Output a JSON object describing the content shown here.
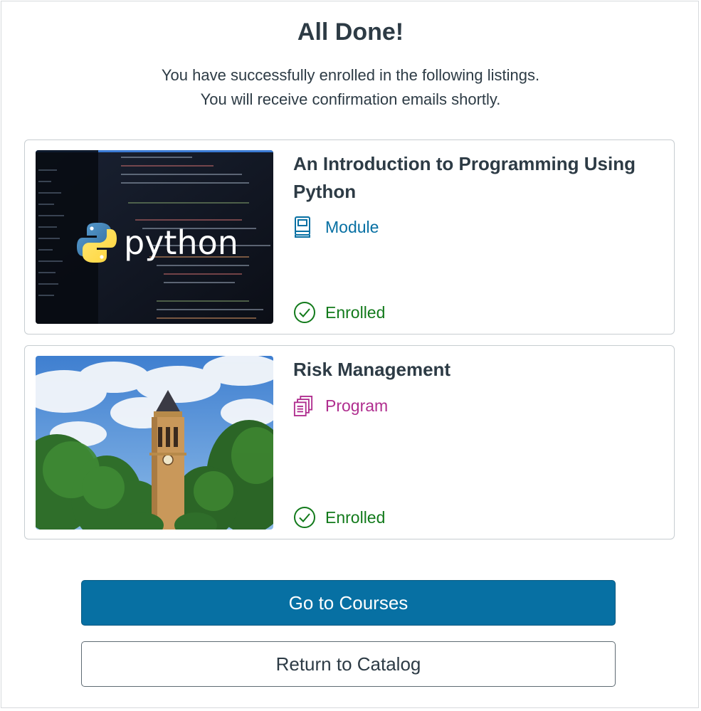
{
  "header": {
    "title": "All Done!",
    "subtitle_line1": "You have successfully enrolled in the following listings.",
    "subtitle_line2": "You will receive confirmation emails shortly."
  },
  "listings": [
    {
      "title": "An Introduction to Programming Using Python",
      "type_label": "Module",
      "type_icon": "book-icon",
      "type_color": "#0770a3",
      "status": "Enrolled",
      "status_icon": "check-circle-icon",
      "status_color": "#127a1b",
      "image_text": "python"
    },
    {
      "title": "Risk Management",
      "type_label": "Program",
      "type_icon": "stacked-documents-icon",
      "type_color": "#b02e8f",
      "status": "Enrolled",
      "status_icon": "check-circle-icon",
      "status_color": "#127a1b"
    }
  ],
  "actions": {
    "primary_label": "Go to Courses",
    "secondary_label": "Return to Catalog"
  },
  "colors": {
    "primary_button": "#0770a3",
    "text": "#2d3b45",
    "border": "#c7cdd1"
  }
}
